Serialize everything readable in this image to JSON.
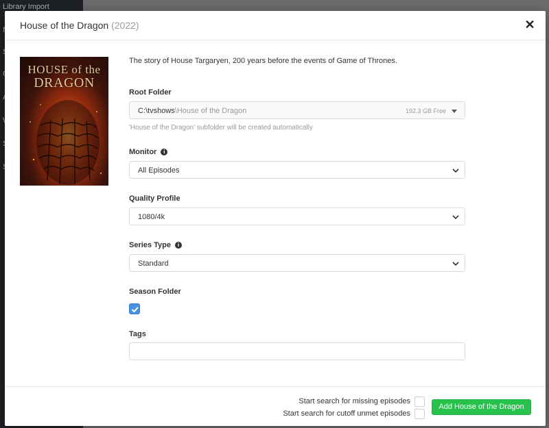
{
  "background": {
    "sidebar_items": [
      "Library Import",
      "N",
      "S",
      "C",
      "A",
      "W",
      "S",
      "S"
    ]
  },
  "modal": {
    "title": "House of the Dragon",
    "year": "(2022)",
    "close_icon": "close-icon"
  },
  "poster": {
    "title_line1": "HOUSE of the",
    "title_line2": "DRAGON"
  },
  "overview": "The story of House Targaryen, 200 years before the events of Game of Thrones.",
  "root_folder": {
    "label": "Root Folder",
    "path": "C:\\tvshows",
    "separator": "\\",
    "subfolder": "House of the Dragon",
    "free_space": "192.3 GB Free",
    "help": "'House of the Dragon' subfolder will be created automatically"
  },
  "monitor": {
    "label": "Monitor",
    "value": "All Episodes",
    "info_icon": "info-icon"
  },
  "quality_profile": {
    "label": "Quality Profile",
    "value": "1080/4k"
  },
  "series_type": {
    "label": "Series Type",
    "value": "Standard",
    "info_icon": "info-icon"
  },
  "season_folder": {
    "label": "Season Folder",
    "checked": true
  },
  "tags": {
    "label": "Tags",
    "value": ""
  },
  "footer": {
    "search_missing_label": "Start search for missing episodes",
    "search_cutoff_label": "Start search for cutoff unmet episodes",
    "add_button_label": "Add House of the Dragon"
  },
  "colors": {
    "accent_blue": "#4a90e2",
    "success_green": "#27c24c",
    "sidebar_bg": "#23262b"
  }
}
